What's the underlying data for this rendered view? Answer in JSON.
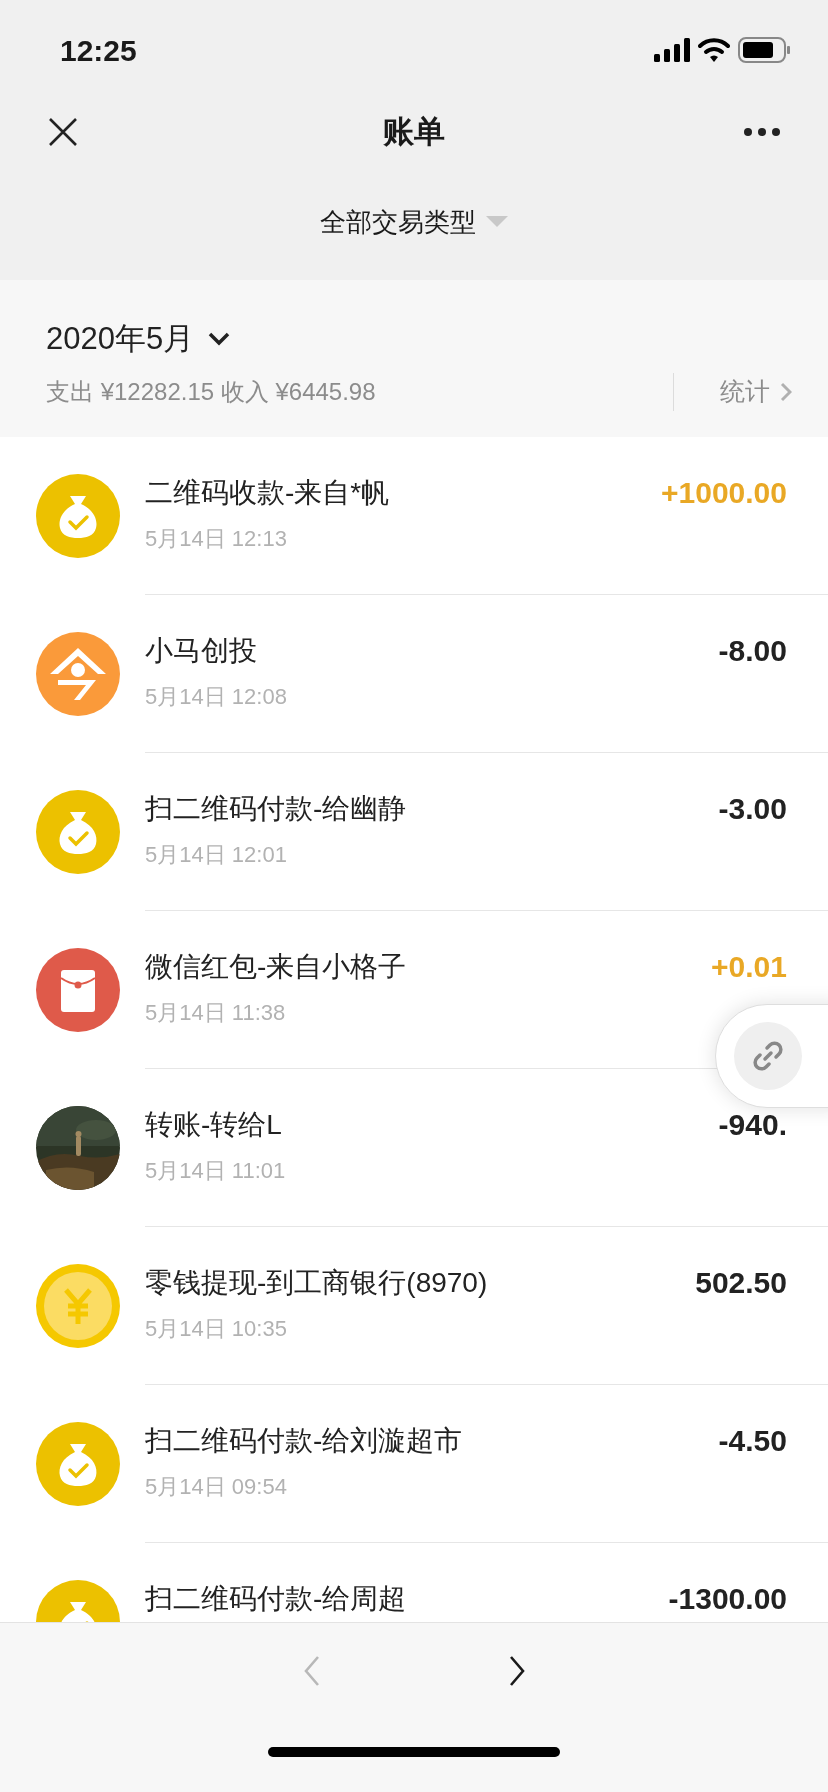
{
  "status_bar": {
    "time": "12:25"
  },
  "nav": {
    "title": "账单"
  },
  "filter": {
    "label": "全部交易类型"
  },
  "month": {
    "label": "2020年5月",
    "summary": "支出 ¥12282.15 收入 ¥6445.98",
    "stats_link": "统计"
  },
  "transactions": [
    {
      "kind": "bag",
      "title": "二维码收款-来自*帆",
      "time": "5月14日 12:13",
      "amount": "+1000.00",
      "income": true
    },
    {
      "kind": "house",
      "title": "小马创投",
      "time": "5月14日 12:08",
      "amount": "-8.00",
      "income": false
    },
    {
      "kind": "bag",
      "title": "扫二维码付款-给幽静",
      "time": "5月14日 12:01",
      "amount": "-3.00",
      "income": false
    },
    {
      "kind": "red_packet",
      "title": "微信红包-来自小格子",
      "time": "5月14日 11:38",
      "amount": "+0.01",
      "income": true
    },
    {
      "kind": "picture",
      "title": "转账-转给L",
      "time": "5月14日 11:01",
      "amount": "-940.",
      "income": false
    },
    {
      "kind": "coin",
      "title": "零钱提现-到工商银行(8970)",
      "time": "5月14日 10:35",
      "amount": "502.50",
      "income": false
    },
    {
      "kind": "bag",
      "title": "扫二维码付款-给刘漩超市",
      "time": "5月14日 09:54",
      "amount": "-4.50",
      "income": false
    },
    {
      "kind": "bag",
      "title": "扫二维码付款-给周超",
      "amount": "-1300.00",
      "income": false
    }
  ],
  "bottom_nav": {
    "back": {
      "disabled": true
    },
    "forward": {
      "disabled": false
    }
  }
}
